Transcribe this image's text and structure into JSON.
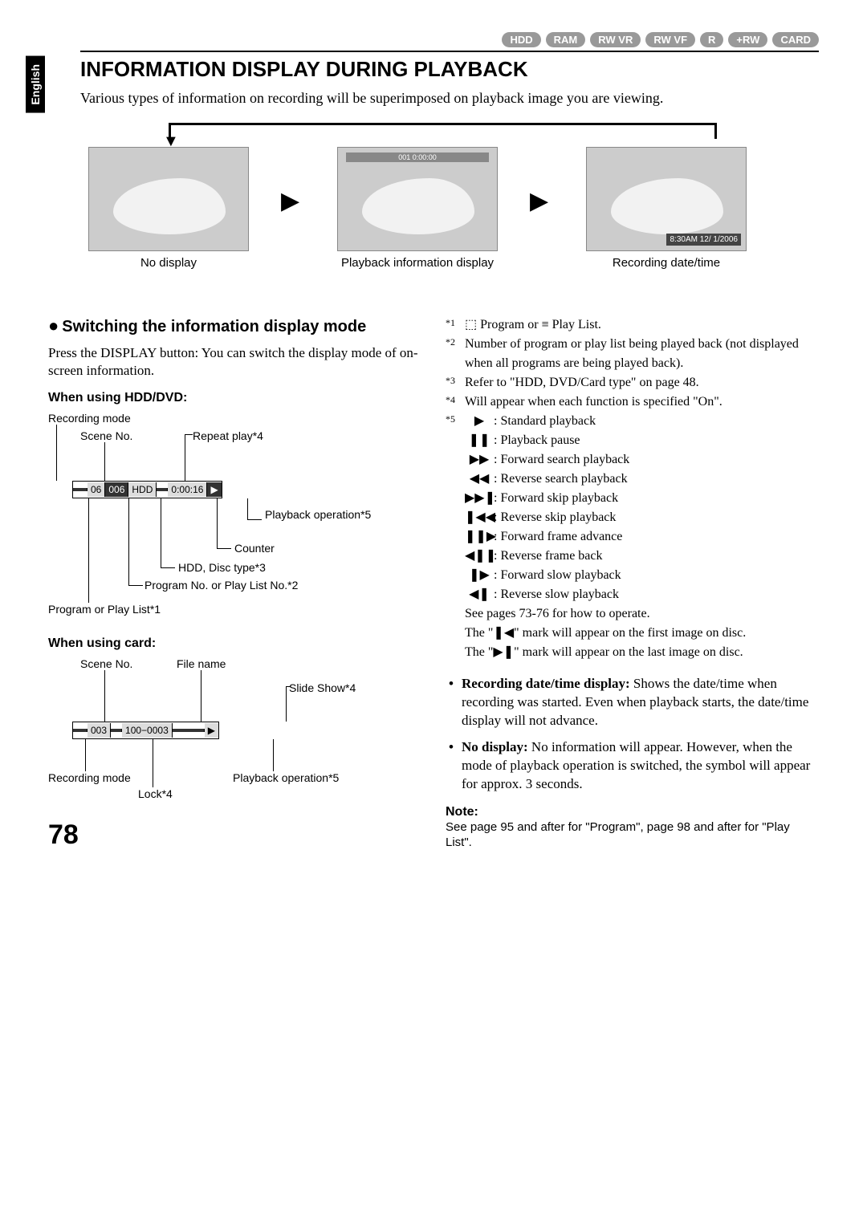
{
  "side_tab": "English",
  "badges": [
    "HDD",
    "RAM",
    "RW VR",
    "RW VF",
    "R",
    "+RW",
    "CARD"
  ],
  "heading": "INFORMATION DISPLAY DURING PLAYBACK",
  "intro": "Various types of information on recording will be superimposed on playback image you are viewing.",
  "cycle": {
    "item1": "No display",
    "item2": "Playback information display",
    "item3": "Recording date/time",
    "overlay_center": "001  0:00:00",
    "overlay_time": "8:30AM\n12/ 1/2006"
  },
  "switch_heading": "Switching the information display mode",
  "switch_text": "Press the DISPLAY button: You can switch the display mode of on-screen information.",
  "hdd_heading": "When using HDD/DVD:",
  "hdd_diagram": {
    "recording_mode": "Recording mode",
    "scene_no": "Scene No.",
    "repeat": "Repeat play*4",
    "playback_op": "Playback operation*5",
    "counter": "Counter",
    "disc_type": "HDD, Disc type*3",
    "program_no": "Program No. or Play List No.*2",
    "program_or": "Program or Play List*1",
    "osd": {
      "a": "",
      "b": "06",
      "c": "006",
      "d": "HDD",
      "e": "",
      "f": "0:00:16",
      "g": "▶"
    }
  },
  "card_heading": "When using card:",
  "card_diagram": {
    "scene_no": "Scene No.",
    "file_name": "File name",
    "slide_show": "Slide Show*4",
    "recording_mode": "Recording mode",
    "lock": "Lock*4",
    "playback_op": "Playback operation*5",
    "osd": {
      "a": "",
      "b": "003",
      "c": "",
      "d": "100−0003",
      "e": "",
      "f": "▶"
    }
  },
  "footnotes": {
    "f1": "Program or ≡ Play List.",
    "f2": "Number of program or play list being played back (not displayed when all programs are being played back).",
    "f3": "Refer to \"HDD, DVD/Card type\" on page 48.",
    "f4": "Will appear when each function is specified \"On\".",
    "f5_intro": "",
    "ops": [
      {
        "sym": "▶",
        "text": "Standard playback"
      },
      {
        "sym": "❚❚",
        "text": "Playback pause"
      },
      {
        "sym": "▶▶",
        "text": "Forward search playback"
      },
      {
        "sym": "◀◀",
        "text": "Reverse search playback"
      },
      {
        "sym": "▶▶❚",
        "text": "Forward skip playback"
      },
      {
        "sym": "❚◀◀",
        "text": "Reverse skip playback"
      },
      {
        "sym": "❚❚▶",
        "text": "Forward frame advance"
      },
      {
        "sym": "◀❚❚",
        "text": "Reverse frame back"
      },
      {
        "sym": "❚▶",
        "text": "Forward slow playback"
      },
      {
        "sym": "◀❚",
        "text": "Reverse slow playback"
      }
    ],
    "f5_after1": "See pages 73-76 for how to operate.",
    "f5_after2": "The \"❚◀\" mark will appear on the first image on disc.",
    "f5_after3": "The \"▶❚\" mark will appear on the last image on disc."
  },
  "bullets": {
    "b1_bold": "Recording date/time display:",
    "b1_text": " Shows the date/time when recording was started. Even when playback starts, the date/time display will not advance.",
    "b2_bold": "No display:",
    "b2_text": " No information will appear. However, when the mode of playback operation is switched, the symbol will appear for approx. 3 seconds."
  },
  "note_heading": "Note:",
  "note_text": "See page 95 and after for \"Program\", page 98 and after for \"Play List\".",
  "page_number": "78"
}
